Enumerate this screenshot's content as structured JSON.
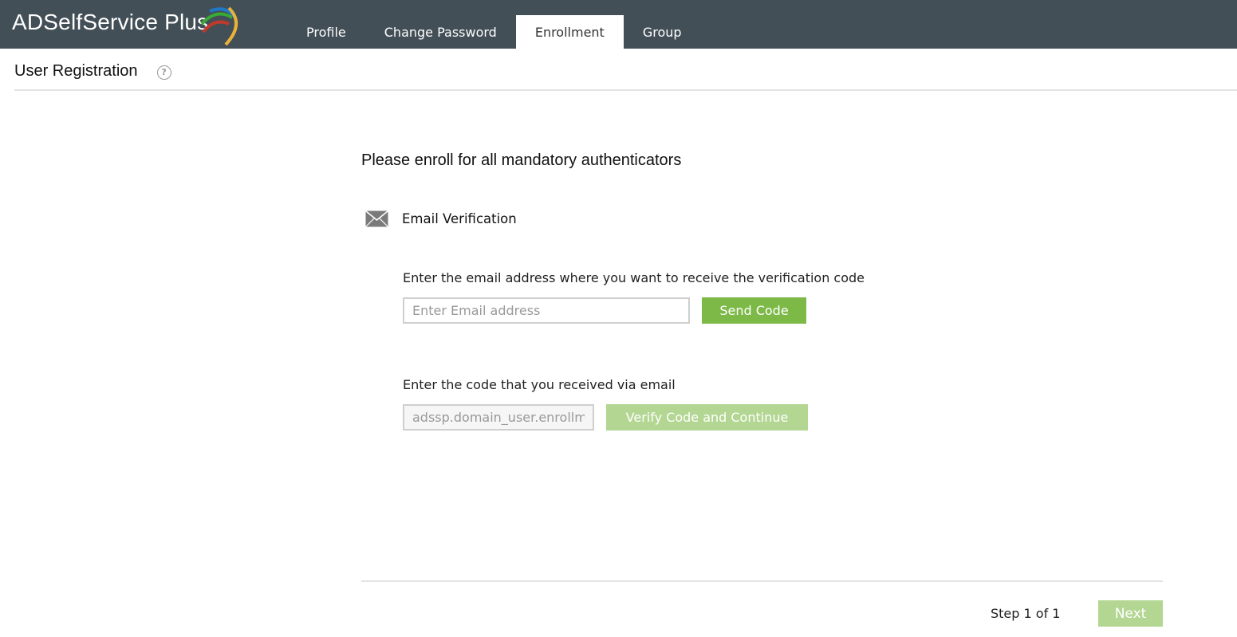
{
  "app": {
    "brand": "ADSelfService Plus",
    "brand_colors": {
      "green": "#3aaa35",
      "red": "#c0392b",
      "blue": "#1f78c8",
      "yellow": "#e8b23a"
    }
  },
  "nav": {
    "tabs": [
      {
        "label": "Profile",
        "active": false
      },
      {
        "label": "Change Password",
        "active": false
      },
      {
        "label": "Enrollment",
        "active": true
      },
      {
        "label": "Group",
        "active": false
      }
    ]
  },
  "page": {
    "title": "User Registration",
    "help_icon": "question-circle-icon",
    "help_glyph": "?"
  },
  "enrollment": {
    "heading": "Please enroll for all mandatory authenticators",
    "authenticator": {
      "icon": "envelope-icon",
      "label": "Email Verification"
    },
    "email_prompt": "Enter the email address where you want to receive the verification code",
    "email_input": {
      "value": "",
      "placeholder": "Enter Email address"
    },
    "send_button": "Send Code",
    "code_prompt": "Enter the code that you received via email",
    "code_input": {
      "value": "adssp.domain_user.enrollment"
    },
    "verify_button": "Verify Code and Continue"
  },
  "footer": {
    "step_text": "Step 1 of 1",
    "next_button": "Next"
  },
  "colors": {
    "topbar": "#434f57",
    "primary_green": "#7cb947",
    "disabled_green": "#b3d692"
  }
}
